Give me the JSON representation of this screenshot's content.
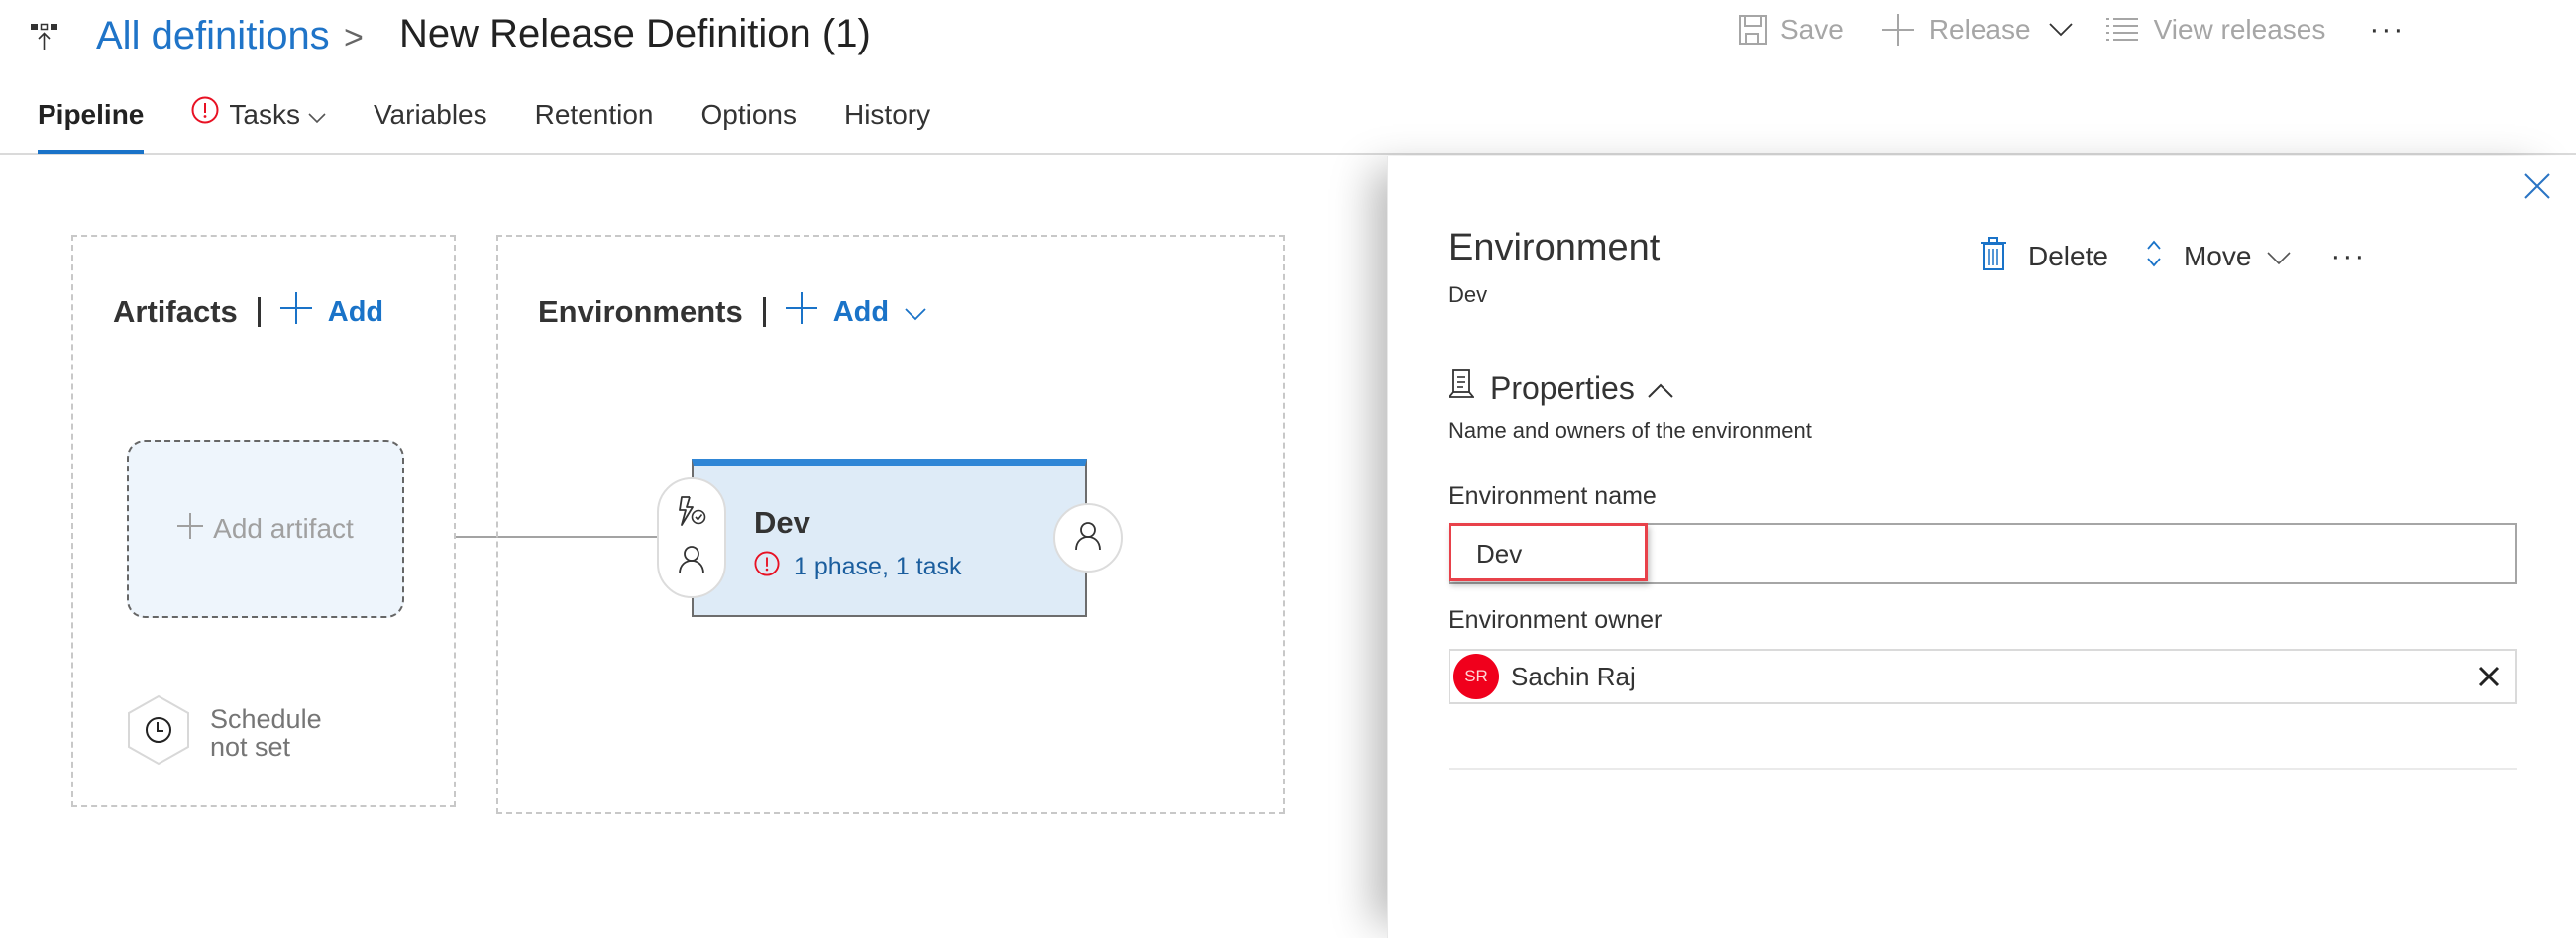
{
  "header": {
    "app_icon": "release-pipeline-icon",
    "breadcrumb_root": "All definitions",
    "breadcrumb_separator": ">",
    "title": "New Release Definition (1)",
    "toolbar": {
      "save_label": "Save",
      "save_icon": "save-icon",
      "release_label": "Release",
      "release_icon": "plus-icon",
      "view_releases_label": "View releases",
      "view_releases_icon": "list-icon",
      "more_label": "···"
    },
    "tabs": [
      {
        "label": "Pipeline",
        "active": true
      },
      {
        "label": "Tasks",
        "warning": true,
        "has_dropdown": true
      },
      {
        "label": "Variables"
      },
      {
        "label": "Retention"
      },
      {
        "label": "Options"
      },
      {
        "label": "History"
      }
    ]
  },
  "pipeline": {
    "artifacts": {
      "title": "Artifacts",
      "add_label": "Add",
      "add_artifact_label": "Add artifact",
      "schedule_line1": "Schedule",
      "schedule_line2": "not set"
    },
    "environments": {
      "title": "Environments",
      "add_label": "Add",
      "cards": [
        {
          "name": "Dev",
          "status": "1 phase, 1 task",
          "status_icon": "warning-icon"
        }
      ]
    }
  },
  "details": {
    "title": "Environment",
    "subtitle": "Dev",
    "actions": {
      "delete_label": "Delete",
      "move_label": "Move",
      "more_label": "···"
    },
    "properties": {
      "title": "Properties",
      "description": "Name and owners of the environment",
      "name_label": "Environment name",
      "name_value": "Dev",
      "owner_label": "Environment owner",
      "owner_name": "Sachin Raj",
      "owner_initials": "SR"
    }
  },
  "colors": {
    "accent": "#1a73c8",
    "warning": "#e81123",
    "card_bg": "#deebf7",
    "card_top": "#2f86d6",
    "avatar": "#f0001c",
    "highlight": "#e8414a"
  }
}
